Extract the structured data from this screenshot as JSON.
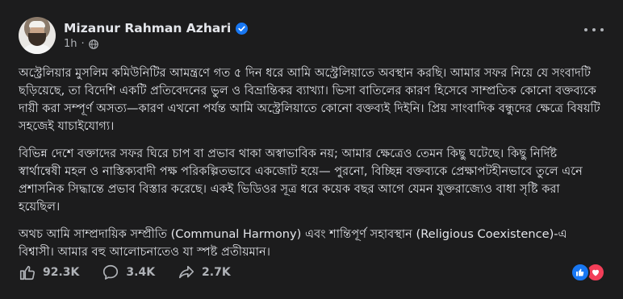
{
  "post": {
    "author": "Mizanur Rahman Azhari",
    "time": "1h",
    "separator": "·",
    "paragraphs": [
      "অস্ট্রেলিয়ার মুসলিম কমিউনিটির আমন্ত্রণে গত ৫ দিন ধরে আমি অস্ট্রেলিয়াতে অবস্থান করছি। আমার সফর নিয়ে যে সংবাদটি ছড়িয়েছে, তা বিদেশি একটি প্রতিবেদনের ভুল ও বিভ্রান্তিকর ব্যাখ্যা। ভিসা বাতিলের কারণ হিসেবে সাম্প্রতিক কোনো বক্তব্যকে দায়ী করা সম্পূর্ণ অসত্য—কারণ এখনো পর্যন্ত আমি অস্ট্রেলিয়াতে কোনো বক্তব্যই দিইনি। প্রিয় সাংবাদিক বন্ধুদের ক্ষেত্রে বিষয়টি সহজেই যাচাইযোগ্য।",
      "বিভিন্ন দেশে বক্তাদের সফর ঘিরে চাপ বা প্রভাব থাকা অস্বাভাবিক নয়; আমার ক্ষেত্রেও তেমন কিছু ঘটেছে। কিছু নির্দিষ্ট স্বার্থান্বেষী মহল ও নাস্তিক্যবাদী পক্ষ পরিকল্পিতভাবে একজোট হয়ে— পুরনো, বিচ্ছিন্ন বক্তব্যকে প্রেক্ষাপটহীনভাবে তুলে এনে প্রশাসনিক সিদ্ধান্তে প্রভাব বিস্তার করেছে। একই ভিডিওর সূত্র ধরে কয়েক বছর আগে যেমন যুক্তরাজ্যেও বাধা সৃষ্টি করা হয়েছিল।",
      "অথচ আমি সাম্প্রদায়িক সম্প্রীতি (Communal Harmony) এবং শান্তিপূর্ণ সহাবস্থান (Religious Coexistence)-এ বিশ্বাসী। আমার বহু আলোচনাতেও যা স্পষ্ট প্রতীয়মান।"
    ]
  },
  "footer": {
    "likes": "92.3K",
    "comments": "3.4K",
    "shares": "2.7K"
  },
  "icons": {
    "verified": "verified-badge-icon",
    "globe": "globe-icon",
    "more": "more-options-icon",
    "like": "like-icon",
    "comment": "comment-icon",
    "share": "share-icon",
    "like_reaction": "like-reaction-icon",
    "love_reaction": "love-reaction-icon"
  },
  "colors": {
    "background": "#1c1c1d",
    "text": "#e4e6eb",
    "secondary": "#b0b3b8",
    "verified": "#1877f2",
    "love": "#f33e58"
  }
}
